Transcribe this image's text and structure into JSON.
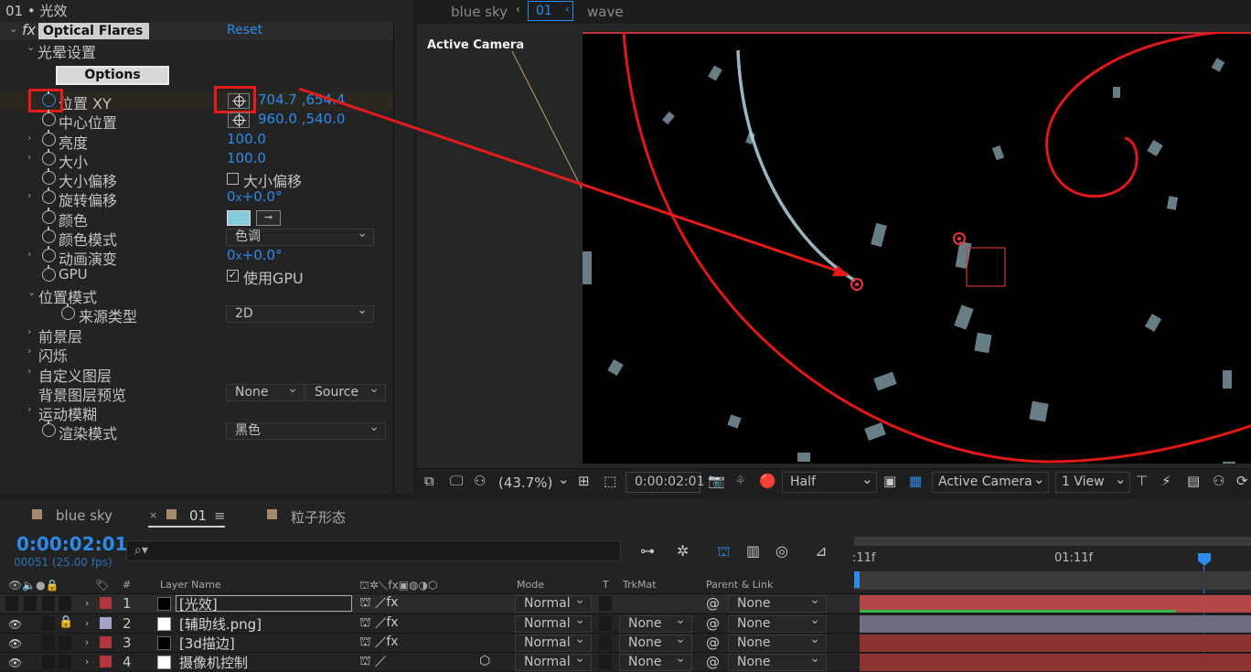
{
  "effect_controls": {
    "header": "01 • 光效",
    "effect_name": "Optical Flares",
    "reset": "Reset",
    "fx_label": "fx",
    "group_guangyun": "光晕设置",
    "options_button": "Options",
    "rows": [
      {
        "label": "位置 XY",
        "value": "704.7 ,654.4"
      },
      {
        "label": "中心位置",
        "value": "960.0 ,540.0"
      },
      {
        "label": "亮度",
        "value": "100.0"
      },
      {
        "label": "大小",
        "value": "100.0"
      },
      {
        "label": "大小偏移",
        "value": "大小偏移"
      },
      {
        "label": "旋转偏移",
        "value_prefix": "0",
        "value_x": "x",
        "value": "+0.0°"
      },
      {
        "label": "颜色",
        "value": ""
      },
      {
        "label": "颜色模式",
        "value": "色调"
      },
      {
        "label": "动画演变",
        "value_prefix": "0",
        "value_x": "x",
        "value": "+0.0°"
      },
      {
        "label": "GPU",
        "value": "使用GPU"
      },
      {
        "label": "位置模式",
        "value": ""
      },
      {
        "label": "来源类型",
        "value": "2D"
      },
      {
        "label": "前景层",
        "value": ""
      },
      {
        "label": "闪烁",
        "value": ""
      },
      {
        "label": "自定义图层",
        "value": ""
      },
      {
        "label": "背景图层预览",
        "value": "None",
        "value2": "Source"
      },
      {
        "label": "运动模糊",
        "value": ""
      },
      {
        "label": "渲染模式",
        "value": "黑色"
      }
    ],
    "color_swatch": "#87c9dd"
  },
  "viewer": {
    "tabs": [
      "blue sky",
      "01",
      "wave"
    ],
    "active_camera_label": "Active Camera",
    "toolbar": {
      "zoom": "(43.7%)",
      "timecode": "0:00:02:01",
      "resolution": "Half",
      "camera": "Active Camera",
      "views": "1 View"
    }
  },
  "timeline": {
    "tabs": [
      "blue sky",
      "01",
      "粒子形态"
    ],
    "timecode": "0:00:02:01",
    "frame_info": "00051 (25.00 fps)",
    "ruler_labels": [
      ":11f",
      "01:11f"
    ],
    "headers": {
      "num": "#",
      "layer_name": "Layer Name",
      "mode": "Mode",
      "t": "T",
      "trkmat": "TrkMat",
      "parent": "Parent & Link"
    },
    "layers": [
      {
        "num": "1",
        "name": "[光效]",
        "mode": "Normal",
        "trkmat": "",
        "parent": "None",
        "label_color": "#b0383a"
      },
      {
        "num": "2",
        "name": "[辅助线.png]",
        "mode": "Normal",
        "trkmat": "None",
        "parent": "None",
        "label_color": "#a3a2c8"
      },
      {
        "num": "3",
        "name": "[3d描边]",
        "mode": "Normal",
        "trkmat": "None",
        "parent": "None",
        "label_color": "#b0383a"
      },
      {
        "num": "4",
        "name": "摄像机控制",
        "mode": "Normal",
        "trkmat": "None",
        "parent": "None",
        "label_color": "#b0383a"
      }
    ]
  },
  "colors": {
    "accent": "#2d8ceb",
    "highlight": "#e51b1b"
  }
}
